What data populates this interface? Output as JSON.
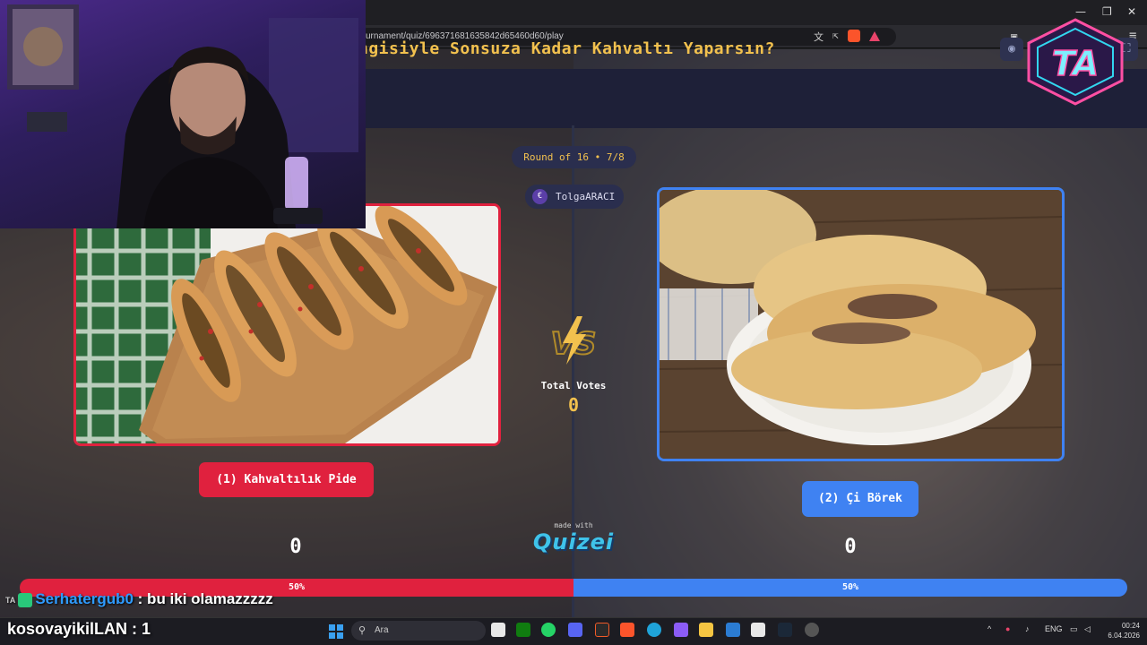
{
  "browser": {
    "url": "urnament/quiz/696371681635842d65460d60/play"
  },
  "quiz": {
    "title": "ngisiyle Sonsuza Kadar Kahvaltı Yaparsın?",
    "round_label": "Round of 16 • 7/8",
    "author": "TolgaARACI",
    "total_votes_label": "Total Votes",
    "total_votes": "0",
    "left_option": {
      "label": "(1) Kahvaltılık Pide",
      "votes": "0",
      "percent_label": "50%"
    },
    "right_option": {
      "label": "(2) Çi Börek",
      "votes": "0",
      "percent_label": "50%"
    },
    "vs_text": "VS",
    "made_with": "made with",
    "brand": "Quizei"
  },
  "stream": {
    "chat_user": "Serhatergub0",
    "chat_message": ": bu iki olamazzzzz",
    "alert_text": "kosovayikilLAN : 1",
    "logo_text": "TA"
  },
  "taskbar": {
    "search_placeholder": "Ara",
    "language": "ENG",
    "time": "00:24",
    "date": "6.04.2026"
  },
  "colors": {
    "left_accent": "#e0213e",
    "right_accent": "#3f82f2",
    "title_gold": "#f2c14e",
    "header_bg": "#1e2038"
  }
}
